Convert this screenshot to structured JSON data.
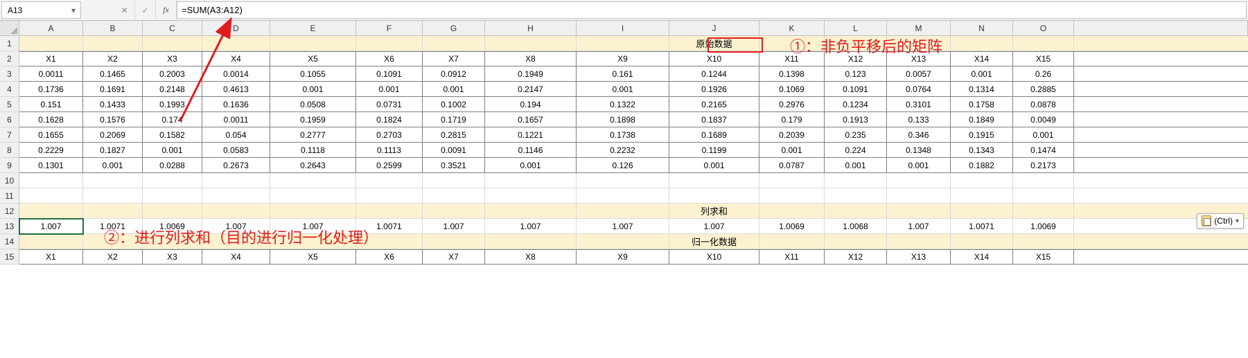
{
  "nameBox": "A13",
  "formula": "=SUM(A3:A12)",
  "columns": [
    "A",
    "B",
    "C",
    "D",
    "E",
    "F",
    "G",
    "H",
    "I",
    "J",
    "K",
    "L",
    "M",
    "N",
    "O"
  ],
  "rowNums": [
    "1",
    "2",
    "3",
    "4",
    "5",
    "6",
    "7",
    "8",
    "9",
    "10",
    "11",
    "12",
    "13",
    "14",
    "15"
  ],
  "banner1": "原始数据",
  "banner12": "列求和",
  "banner14": "归一化数据",
  "headersX": [
    "X1",
    "X2",
    "X3",
    "X4",
    "X5",
    "X6",
    "X7",
    "X8",
    "X9",
    "X10",
    "X11",
    "X12",
    "X13",
    "X14",
    "X15"
  ],
  "data": [
    [
      "0.0011",
      "0.1465",
      "0.2003",
      "0.0014",
      "0.1055",
      "0.1091",
      "0.0912",
      "0.1949",
      "0.161",
      "0.1244",
      "0.1398",
      "0.123",
      "0.0057",
      "0.001",
      "0.26"
    ],
    [
      "0.1736",
      "0.1691",
      "0.2148",
      "0.4613",
      "0.001",
      "0.001",
      "0.001",
      "0.2147",
      "0.001",
      "0.1926",
      "0.1069",
      "0.1091",
      "0.0764",
      "0.1314",
      "0.2885"
    ],
    [
      "0.151",
      "0.1433",
      "0.1993",
      "0.1636",
      "0.0508",
      "0.0731",
      "0.1002",
      "0.194",
      "0.1322",
      "0.2165",
      "0.2976",
      "0.1234",
      "0.3101",
      "0.1758",
      "0.0878"
    ],
    [
      "0.1628",
      "0.1576",
      "0.174",
      "0.0011",
      "0.1959",
      "0.1824",
      "0.1719",
      "0.1657",
      "0.1898",
      "0.1837",
      "0.179",
      "0.1913",
      "0.133",
      "0.1849",
      "0.0049"
    ],
    [
      "0.1655",
      "0.2069",
      "0.1582",
      "0.054",
      "0.2777",
      "0.2703",
      "0.2815",
      "0.1221",
      "0.1738",
      "0.1689",
      "0.2039",
      "0.235",
      "0.346",
      "0.1915",
      "0.001"
    ],
    [
      "0.2229",
      "0.1827",
      "0.001",
      "0.0583",
      "0.1118",
      "0.1113",
      "0.0091",
      "0.1146",
      "0.2232",
      "0.1199",
      "0.001",
      "0.224",
      "0.1348",
      "0.1343",
      "0.1474"
    ],
    [
      "0.1301",
      "0.001",
      "0.0288",
      "0.2673",
      "0.2643",
      "0.2599",
      "0.3521",
      "0.001",
      "0.126",
      "0.001",
      "0.0787",
      "0.001",
      "0.001",
      "0.1882",
      "0.2173"
    ]
  ],
  "sums": [
    "1.007",
    "1.0071",
    "1.0069",
    "1.007",
    "1.007",
    "1.0071",
    "1.007",
    "1.007",
    "1.007",
    "1.007",
    "1.0069",
    "1.0068",
    "1.007",
    "1.0071",
    "1.0069"
  ],
  "anno1": "①：非负平移后的矩阵",
  "anno2": "②：进行列求和（目的进行归一化处理）",
  "pasteOpt": "(Ctrl)",
  "chart_data": {
    "type": "table",
    "title": "原始数据",
    "columns": [
      "X1",
      "X2",
      "X3",
      "X4",
      "X5",
      "X6",
      "X7",
      "X8",
      "X9",
      "X10",
      "X11",
      "X12",
      "X13",
      "X14",
      "X15"
    ],
    "rows": [
      [
        0.0011,
        0.1465,
        0.2003,
        0.0014,
        0.1055,
        0.1091,
        0.0912,
        0.1949,
        0.161,
        0.1244,
        0.1398,
        0.123,
        0.0057,
        0.001,
        0.26
      ],
      [
        0.1736,
        0.1691,
        0.2148,
        0.4613,
        0.001,
        0.001,
        0.001,
        0.2147,
        0.001,
        0.1926,
        0.1069,
        0.1091,
        0.0764,
        0.1314,
        0.2885
      ],
      [
        0.151,
        0.1433,
        0.1993,
        0.1636,
        0.0508,
        0.0731,
        0.1002,
        0.194,
        0.1322,
        0.2165,
        0.2976,
        0.1234,
        0.3101,
        0.1758,
        0.0878
      ],
      [
        0.1628,
        0.1576,
        0.174,
        0.0011,
        0.1959,
        0.1824,
        0.1719,
        0.1657,
        0.1898,
        0.1837,
        0.179,
        0.1913,
        0.133,
        0.1849,
        0.0049
      ],
      [
        0.1655,
        0.2069,
        0.1582,
        0.054,
        0.2777,
        0.2703,
        0.2815,
        0.1221,
        0.1738,
        0.1689,
        0.2039,
        0.235,
        0.346,
        0.1915,
        0.001
      ],
      [
        0.2229,
        0.1827,
        0.001,
        0.0583,
        0.1118,
        0.1113,
        0.0091,
        0.1146,
        0.2232,
        0.1199,
        0.001,
        0.224,
        0.1348,
        0.1343,
        0.1474
      ],
      [
        0.1301,
        0.001,
        0.0288,
        0.2673,
        0.2643,
        0.2599,
        0.3521,
        0.001,
        0.126,
        0.001,
        0.0787,
        0.001,
        0.001,
        0.1882,
        0.2173
      ]
    ],
    "column_sums": [
      1.007,
      1.0071,
      1.0069,
      1.007,
      1.007,
      1.0071,
      1.007,
      1.007,
      1.007,
      1.007,
      1.0069,
      1.0068,
      1.007,
      1.0071,
      1.0069
    ]
  }
}
